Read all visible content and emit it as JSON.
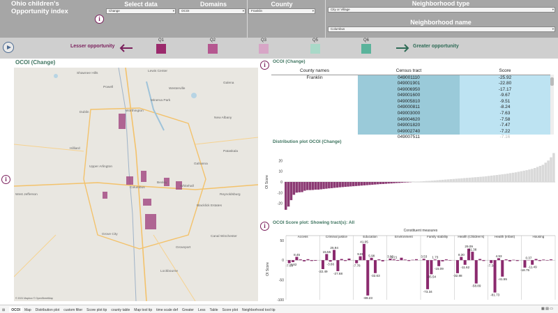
{
  "header": {
    "app_title": "Ohio children's Opportunity index",
    "select_data_label": "Select data",
    "select_data_value": "Change",
    "domains_label": "Domains",
    "domains_value": "OCOI",
    "county_label": "County",
    "county_value": "Franklin",
    "neighborhood_type_label": "Neighborhood type",
    "neighborhood_type_value": "City or Village",
    "neighborhood_name_label": "Neighborhood name",
    "neighborhood_name_value": "Columbus"
  },
  "legend": {
    "lesser": "Lesser opportunity",
    "greater": "Greater opportunity",
    "quintiles": [
      {
        "label": "Q1",
        "color": "#9b2a6c"
      },
      {
        "label": "Q2",
        "color": "#b55790"
      },
      {
        "label": "Q3",
        "color": "#d7a6c6"
      },
      {
        "label": "Q5",
        "color": "#a9d9c8"
      },
      {
        "label": "Q6",
        "color": "#5ab39b"
      }
    ],
    "arrow_left_color": "#7a1f5c",
    "arrow_right_color": "#2e6b56"
  },
  "map": {
    "title": "OCOI (Change)",
    "labels": [
      "Westerville",
      "Worthington",
      "Dublin",
      "New Albany",
      "Upper Arlington",
      "Gahanna",
      "Columbus",
      "Bexley",
      "Whitehall",
      "Reynoldsburg",
      "Grove City",
      "Groveport",
      "West Jefferson",
      "Shawnee Hills",
      "Lewis Center",
      "Powell",
      "Galena",
      "Pataskala",
      "Lockbourne",
      "Canal Winchester",
      "Blacklick Estates",
      "Minerva Park",
      "Hilliard"
    ],
    "credit": "© 2021 Mapbox © OpenStreetMap"
  },
  "table": {
    "title": "OCOI (Change)",
    "col_county": "County names",
    "col_tract": "Census tract",
    "col_score": "Score",
    "county": "Franklin",
    "rows": [
      {
        "tract": "049001110",
        "score": "-25.92"
      },
      {
        "tract": "049001901",
        "score": "-22.80"
      },
      {
        "tract": "049006950",
        "score": "-17.17"
      },
      {
        "tract": "049001600",
        "score": "-9.67"
      },
      {
        "tract": "049005810",
        "score": "-9.51"
      },
      {
        "tract": "049000811",
        "score": "-8.24"
      },
      {
        "tract": "049003000",
        "score": "-7.63"
      },
      {
        "tract": "049004620",
        "score": "-7.58"
      },
      {
        "tract": "049001820",
        "score": "-7.47"
      },
      {
        "tract": "049002740",
        "score": "-7.22"
      },
      {
        "tract": "049007511",
        "score": "-7.16"
      }
    ]
  },
  "chart_data": [
    {
      "type": "bar",
      "title": "Distribution plot OCOI (Change)",
      "ylabel": "OI Score",
      "ylim": [
        -28,
        28
      ],
      "yticks": [
        -20,
        -10,
        0,
        10,
        20
      ],
      "values": [
        -26,
        -23,
        -17,
        -12,
        -10,
        -9.7,
        -9.5,
        -8.2,
        -7.6,
        -7.6,
        -7.5,
        -7.2,
        -7.2,
        -6.9,
        -6.6,
        -6.3,
        -6,
        -5.8,
        -5.5,
        -5.3,
        -5,
        -4.8,
        -4.6,
        -4.4,
        -4.2,
        -4,
        -3.8,
        -3.6,
        -3.4,
        -3.2,
        -3,
        -2.8,
        -2.6,
        -2.4,
        -2.2,
        -2,
        -1.9,
        -1.7,
        -1.5,
        -1.4,
        -1.2,
        -1,
        -0.9,
        -0.7,
        -0.5,
        -0.4,
        -0.2,
        0,
        0.2,
        0.4,
        0.5,
        0.7,
        0.9,
        1,
        1.2,
        1.4,
        1.6,
        1.8,
        2,
        2.2,
        2.4,
        2.6,
        2.8,
        3,
        3.2,
        3.4,
        3.6,
        3.8,
        4,
        4.2,
        4.4,
        4.6,
        4.8,
        5,
        5.3,
        5.6,
        5.9,
        6.2,
        6.5,
        6.8,
        7.1,
        7.4,
        7.8,
        8.2,
        8.6,
        9,
        9.5,
        10,
        10.5,
        11,
        11.6,
        12.2,
        13,
        14,
        15,
        16,
        18,
        20,
        23,
        27
      ],
      "neg_color": "#8b3a73",
      "pos_color": "#d9d9d9"
    },
    {
      "type": "bar",
      "title": "OCOI Score plot: Showing tract(s): All",
      "header": "Constituent measures",
      "ylabel": "OI Score",
      "ylim": [
        -100,
        55
      ],
      "yticks": [
        50,
        0,
        -50,
        -100
      ],
      "color": "#8b2a6e",
      "categories": [
        "Access",
        "Criminal justice",
        "Education",
        "Environment",
        "Family stability",
        "Health (Children's)",
        "Health (Infant)",
        "Housing"
      ],
      "groups": [
        {
          "values": [
            -7.63,
            -4.82,
            8.45,
            2.0,
            -3.0,
            2.5,
            -2.0,
            -1.5
          ],
          "labels": [
            "-7.63",
            "-4.82",
            "8.45"
          ]
        },
        {
          "values": [
            -22.49,
            15.55,
            -3.66,
            25.94,
            -27.68,
            3.0,
            -2.0,
            4.0
          ],
          "labels": [
            "-22.49",
            "15.55",
            "-3.66",
            "25.94",
            "-27.68"
          ]
        },
        {
          "values": [
            -7.78,
            9.89,
            41.05,
            -89.23,
            5.98,
            -32.63,
            2.0,
            -3.0
          ],
          "labels": [
            "-7.78",
            "9.89",
            "41.05",
            "-89.23",
            "5.98",
            "-32.63"
          ]
        },
        {
          "values": [
            3.93,
            2.0,
            -1.5,
            6.21,
            1.5,
            -2.0,
            1.0,
            2.5
          ],
          "labels": [
            "3.93",
            "6.21"
          ]
        },
        {
          "values": [
            3.53,
            -73.34,
            -35.54,
            1.73,
            -15.09,
            -3.0,
            2.0,
            -1.0
          ],
          "labels": [
            "3.53",
            "-73.34",
            "-35.54",
            "1.73",
            "-15.09"
          ]
        },
        {
          "values": [
            -32.88,
            8.3,
            -11.62,
            29.09,
            21.38,
            -58.89,
            3.0,
            -2.0
          ],
          "labels": [
            "-32.88",
            "8.30",
            "-11.62",
            "29.09",
            "21.38",
            "-58.89"
          ]
        },
        {
          "values": [
            -7.34,
            -81.73,
            4.93,
            -41.55,
            2.0,
            -3.0,
            1.0,
            -2.0
          ],
          "labels": [
            "-7.34",
            "-81.73",
            "4.93",
            "-41.55"
          ]
        },
        {
          "values": [
            -18.75,
            0.37,
            -11.49,
            3.0,
            -2.0,
            1.5,
            -1.0,
            2.0
          ],
          "labels": [
            "-18.75",
            "0.37",
            "-11.49"
          ]
        }
      ]
    }
  ],
  "tabs": [
    "OCOI",
    "Map",
    "Distribution plot",
    "custom filter",
    "Score plot tip",
    "county table",
    "Map tool tip",
    "time scale def",
    "Greater",
    "Less",
    "Table",
    "Score plot",
    "Neighborhood tool tip"
  ]
}
